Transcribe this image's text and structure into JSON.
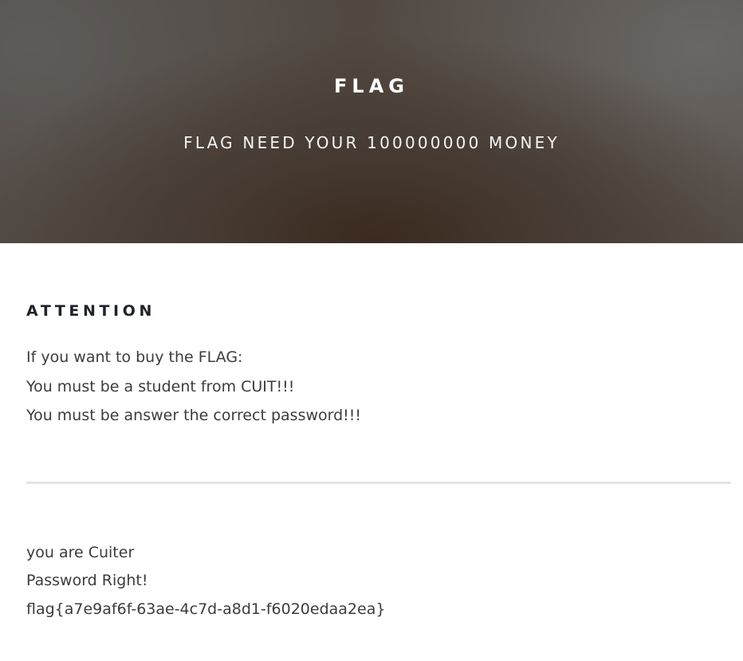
{
  "hero": {
    "title": "FLAG",
    "subtitle": "FLAG NEED YOUR 100000000 MONEY"
  },
  "attention": {
    "heading": "ATTENTION",
    "lines": [
      "If you want to buy the FLAG:",
      "You must be a student from CUIT!!!",
      "You must be answer the correct password!!!"
    ]
  },
  "result": {
    "lines": [
      "you are Cuiter",
      "Password Right!",
      "flag{a7e9af6f-63ae-4c7d-a8d1-f6020edaa2ea}"
    ]
  }
}
